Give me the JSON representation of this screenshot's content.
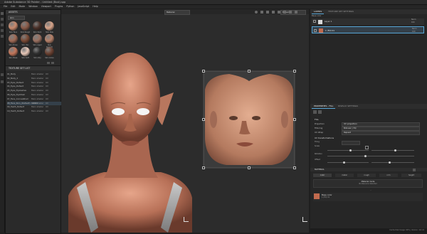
{
  "app": {
    "title": "Adobe Substance 3D Painter - Untitled (Bust).spp"
  },
  "menu": [
    "File",
    "Edit",
    "Mode",
    "Window",
    "Viewport",
    "Plugins",
    "Python",
    "JavaScript",
    "Help"
  ],
  "assets": {
    "title": "ASSETS",
    "filter": "skin",
    "items": [
      {
        "label": "Skin Face",
        "color": "#c98a6d"
      },
      {
        "label": "Skin Rough",
        "color": "#8a5a48"
      },
      {
        "label": "Skin Dark",
        "color": "#4a3028"
      },
      {
        "label": "Skin Pale",
        "color": "#d9a58a"
      },
      {
        "label": "Skin Pores",
        "color": "#a06a55"
      },
      {
        "label": "Skin Tan",
        "color": "#7a4a35"
      },
      {
        "label": "Skin Aged",
        "color": "#9a7060"
      },
      {
        "label": "Skin Smooth",
        "color": "#b68068"
      },
      {
        "label": "Skin Base",
        "color": "#c4765a"
      },
      {
        "label": "Skin Soft",
        "color": "#e8c8b8"
      },
      {
        "label": "Skin Oily",
        "color": "#2f2f2f"
      },
      {
        "label": "Skin Gloss",
        "color": "#6a4030"
      }
    ]
  },
  "texture_set": {
    "title": "TEXTURE SET LIST",
    "items": [
      {
        "name": "01_Body",
        "shader": "Main shader",
        "uv": "UV"
      },
      {
        "name": "02_Body_2",
        "shader": "Main shader",
        "uv": "UV"
      },
      {
        "name": "03_Eyes_Default",
        "shader": "Main shader",
        "uv": "UV"
      },
      {
        "name": "04_Eyes_Default",
        "shader": "Main shader",
        "uv": "UV"
      },
      {
        "name": "05_Eyes_Eyelashes",
        "shader": "Main shader",
        "uv": "UV"
      },
      {
        "name": "06_Eyes_EyeShell",
        "shader": "Main shader",
        "uv": "UV"
      },
      {
        "name": "07_Face_CorneaShell",
        "shader": "Main shader",
        "uv": "UV"
      },
      {
        "name": "08_Face_Skin_(Default) - UDIM",
        "shader": "Main shader",
        "uv": "UV"
      },
      {
        "name": "09_Teeth_Default",
        "shader": "Main shader",
        "uv": "UV"
      },
      {
        "name": "10_Teeth_Default",
        "shader": "Main shader",
        "uv": "UV"
      }
    ]
  },
  "viewport": {
    "material_dropdown": "Material",
    "uv_dropdown": "Material"
  },
  "layers": {
    "tabs": [
      "LAYERS",
      "TEXTURE SET SETTINGS"
    ],
    "blend_label": "Base color",
    "items": [
      {
        "name": "Layer 1",
        "blend": "Norm",
        "opacity": "100"
      },
      {
        "name": "1 (Fill) 01",
        "blend": "Norm",
        "opacity": "100"
      }
    ]
  },
  "properties": {
    "tabs": [
      "PROPERTIES - FILL",
      "DISPLAY SETTINGS"
    ],
    "section_fill": "FILL",
    "rows": [
      {
        "label": "Projection",
        "value": "UV projection"
      },
      {
        "label": "Filtering",
        "value": "Bilinear | HQ"
      },
      {
        "label": "UV Wrap",
        "value": "Repeat"
      }
    ],
    "uv_transformations": "UV transformations",
    "scale_label": "Scale",
    "rotation_label": "Rotation",
    "offset_label": "Offset",
    "tiling": "Tiling",
    "material_section": "MATERIAL",
    "channels": [
      "color",
      "metal",
      "rough",
      "nrm",
      "height"
    ],
    "material_mode": "Material mode",
    "no_resource": "No Resource Selected",
    "base_color": "Base color",
    "base_color_value": "1 (Fill) 01",
    "base_color_hex": "#c26a4e"
  },
  "status": {
    "text": "Cache Disk Usage: 99% | Version: 10.1.0"
  }
}
